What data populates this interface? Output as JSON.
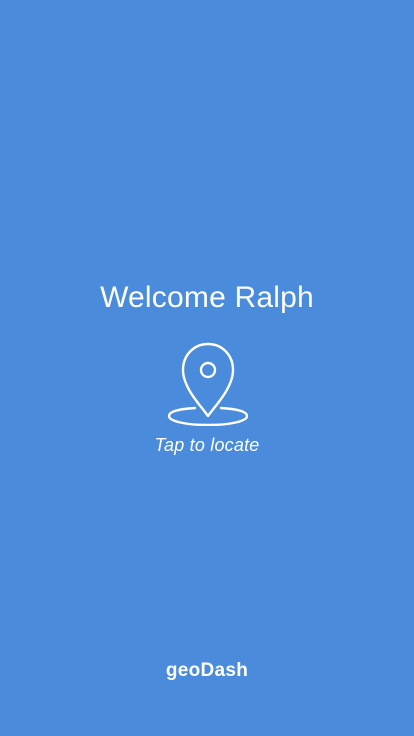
{
  "welcome": {
    "greeting": "Welcome",
    "name": "Ralph"
  },
  "locate": {
    "icon": "location-pin-icon",
    "label": "Tap to locate"
  },
  "footer": {
    "brand": "geoDash"
  },
  "colors": {
    "background": "#4A8BDB",
    "foreground": "#FFFFFF"
  }
}
